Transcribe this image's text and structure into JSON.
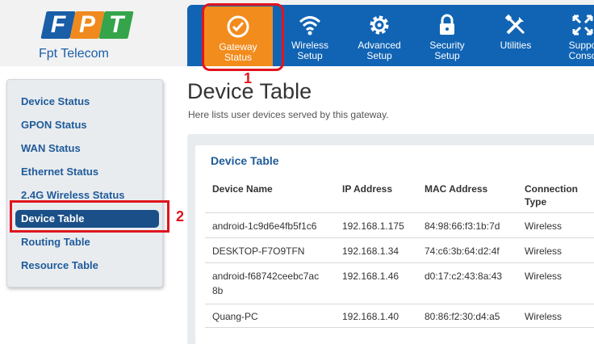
{
  "logo": {
    "letters": [
      "F",
      "P",
      "T"
    ],
    "text": "Fpt Telecom",
    "colors": [
      "#1a5ea8",
      "#f08a1e",
      "#35a44a"
    ]
  },
  "nav": {
    "items": [
      {
        "label": "Gateway\nStatus",
        "icon": "check-circle-icon",
        "active": true
      },
      {
        "label": "Wireless\nSetup",
        "icon": "wifi-icon",
        "active": false
      },
      {
        "label": "Advanced\nSetup",
        "icon": "gear-icon",
        "active": false
      },
      {
        "label": "Security\nSetup",
        "icon": "lock-icon",
        "active": false
      },
      {
        "label": "Utilities",
        "icon": "tools-icon",
        "active": false
      },
      {
        "label": "Suppo\nConso",
        "icon": "arrows-icon",
        "active": false
      }
    ],
    "accent": "#f28c1d",
    "bar_color": "#1164b4"
  },
  "annotations": {
    "one": "1",
    "two": "2",
    "color": "#e0151e"
  },
  "sidebar": {
    "items": [
      {
        "label": "Device Status",
        "active": false
      },
      {
        "label": "GPON Status",
        "active": false
      },
      {
        "label": "WAN Status",
        "active": false
      },
      {
        "label": "Ethernet Status",
        "active": false
      },
      {
        "label": "2.4G Wireless Status",
        "active": false
      },
      {
        "label": "Device Table",
        "active": true
      },
      {
        "label": "Routing Table",
        "active": false
      },
      {
        "label": "Resource Table",
        "active": false
      }
    ]
  },
  "main": {
    "title": "Device Table",
    "subtitle": "Here lists user devices served by this gateway.",
    "card_title": "Device Table",
    "columns": [
      "Device Name",
      "IP Address",
      "MAC Address",
      "Connection\nType"
    ],
    "rows": [
      [
        "android-1c9d6e4fb5f1c6",
        "192.168.1.175",
        "84:98:66:f3:1b:7d",
        "Wireless"
      ],
      [
        "DESKTOP-F7O9TFN",
        "192.168.1.34",
        "74:c6:3b:64:d2:4f",
        "Wireless"
      ],
      [
        "android-f68742ceebc7ac\n8b",
        "192.168.1.46",
        "d0:17:c2:43:8a:43",
        "Wireless"
      ],
      [
        "Quang-PC",
        "192.168.1.40",
        "80:86:f2:30:d4:a5",
        "Wireless"
      ]
    ]
  }
}
